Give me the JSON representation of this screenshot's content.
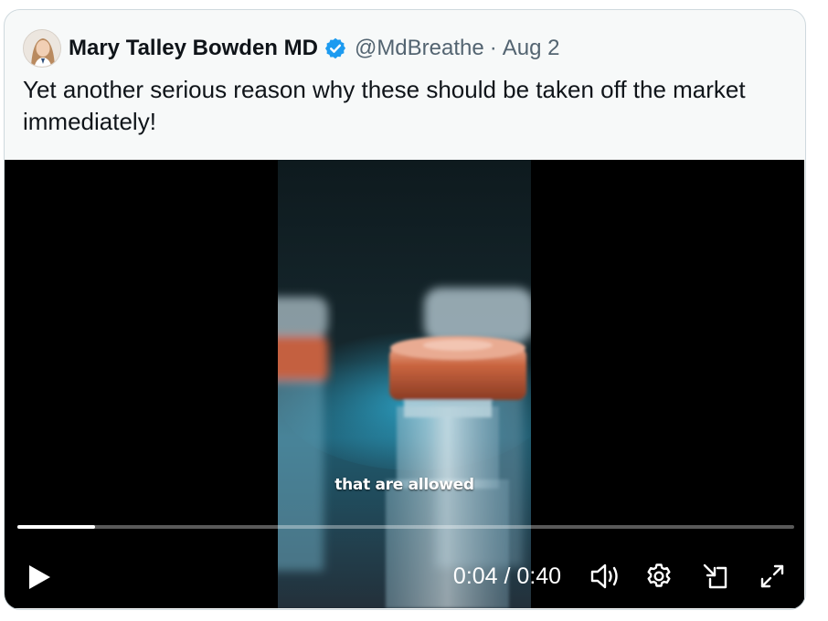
{
  "tweet": {
    "author_name": "Mary Talley Bowden MD",
    "handle": "@MdBreathe",
    "separator": "·",
    "date": "Aug 2",
    "verified": true,
    "text": "Yet another serious reason why these should be taken off the market immediately!"
  },
  "video": {
    "caption": "that are allowed",
    "current_time": "0:04",
    "duration": "0:40",
    "time_display": "0:04 / 0:40",
    "progress_fraction": 0.1,
    "controls": {
      "play_icon": "play-icon",
      "volume_icon": "volume-icon",
      "settings_icon": "gear-icon",
      "pip_icon": "picture-in-picture-icon",
      "fullscreen_icon": "expand-icon"
    }
  },
  "colors": {
    "verified_badge": "#1d9bf0",
    "text_primary": "#0f1419",
    "text_secondary": "#536471",
    "card_border": "#cfd9de",
    "card_background": "#f7f9f9"
  }
}
